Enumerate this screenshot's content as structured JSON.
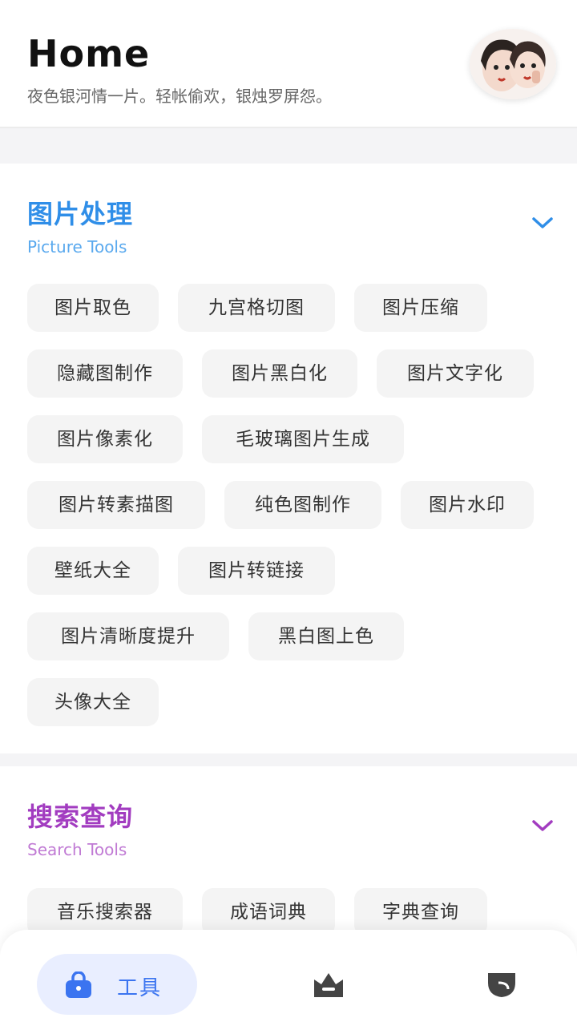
{
  "header": {
    "title": "Home",
    "subtitle": "夜色银河情一片。轻帐偷欢，银烛罗屏怨。"
  },
  "sections": [
    {
      "title": "图片处理",
      "subtitle": "Picture Tools",
      "accent": "#2f8ee8",
      "tools": [
        "图片取色",
        "九宫格切图",
        "图片压缩",
        "隐藏图制作",
        "图片黑白化",
        "图片文字化",
        "图片像素化",
        "毛玻璃图片生成",
        "图片转素描图",
        "纯色图制作",
        "图片水印",
        "壁纸大全",
        "图片转链接",
        "图片清晰度提升",
        "黑白图上色",
        "头像大全"
      ]
    },
    {
      "title": "搜索查询",
      "subtitle": "Search Tools",
      "accent": "#a23cc0",
      "tools": [
        "音乐搜索器",
        "成语词典",
        "字典查询"
      ]
    }
  ],
  "bottom_nav": {
    "items": [
      {
        "label": "工具",
        "icon": "bag-icon",
        "active": true
      },
      {
        "label": "",
        "icon": "crown-icon",
        "active": false
      },
      {
        "label": "",
        "icon": "shield-icon",
        "active": false
      }
    ],
    "active_color": "#3b74f0"
  }
}
